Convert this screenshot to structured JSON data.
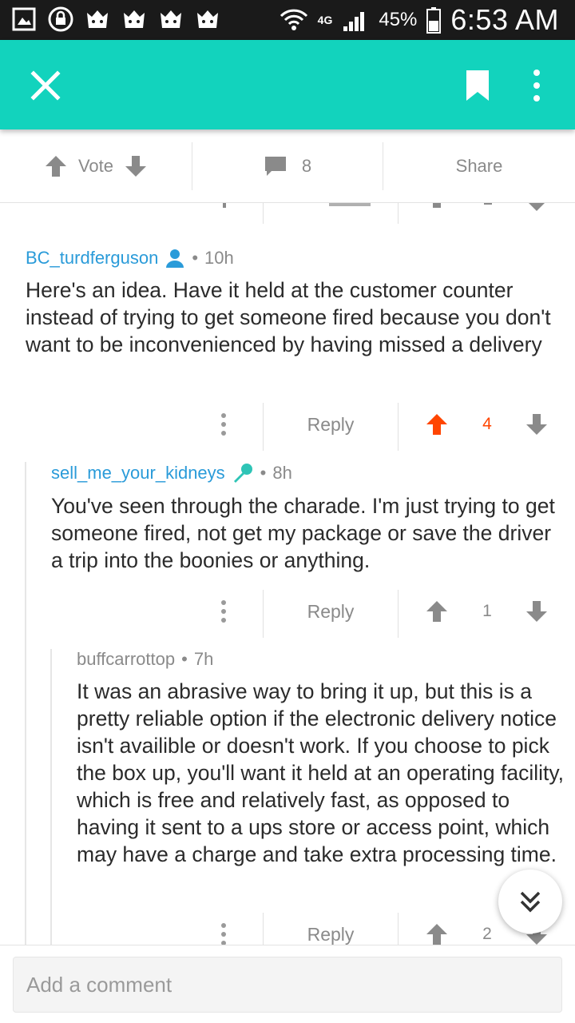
{
  "status_bar": {
    "network": "4G",
    "battery": "45%",
    "time": "6:53 AM"
  },
  "post_actions": {
    "vote_label": "Vote",
    "comment_count": "8",
    "share_label": "Share"
  },
  "comments": [
    {
      "author": "BC_turdferguson",
      "age": "10h",
      "body": "Here's an idea. Have it held at the customer counter instead of trying to get someone fired because you don't want to be inconvenienced by having missed a delivery",
      "reply_label": "Reply",
      "score": "4"
    },
    {
      "author": "sell_me_your_kidneys",
      "age": "8h",
      "body": "You've seen through the charade. I'm just trying to get someone fired, not get my package or save the driver a trip into the boonies or anything.",
      "reply_label": "Reply",
      "score": "1"
    },
    {
      "author": "buffcarrottop",
      "age": "7h",
      "body": "It was an abrasive way to bring it up, but this is a pretty reliable option if the electronic delivery notice isn't availible or doesn't work. If you choose to pick the box up, you'll want it held at an operating facility, which is free and relatively fast, as opposed to having it sent to a ups store or access point, which may have a charge and take extra processing time.",
      "reply_label": "Reply",
      "score": "2"
    }
  ],
  "composer": {
    "placeholder": "Add a comment"
  },
  "colors": {
    "toolbar": "#12d3bd",
    "link": "#2a9bd9",
    "upvoted": "#ff4500"
  }
}
